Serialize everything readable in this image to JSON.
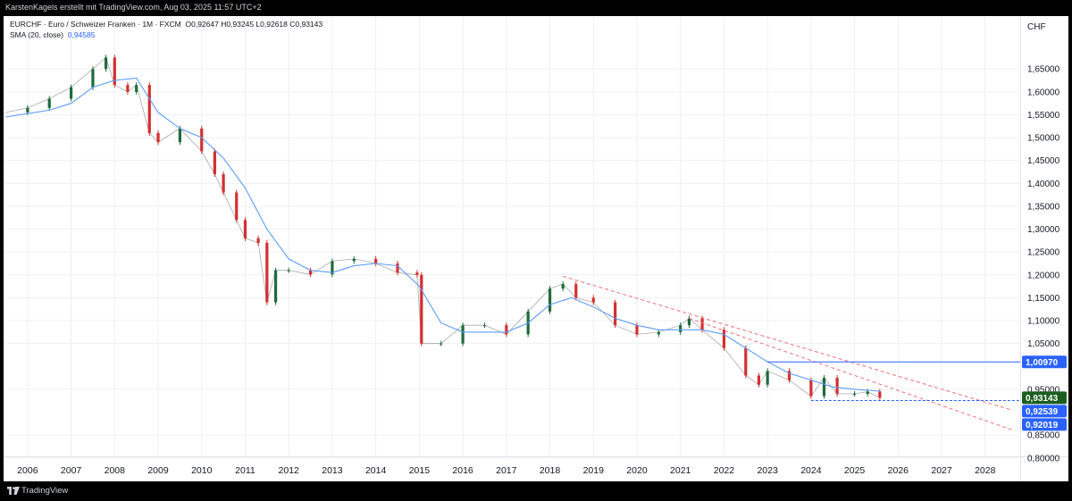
{
  "header": {
    "attribution": "KarstenKagels erstellt mit TradingView.com, Aug 03, 2025 11:57 UTC+2"
  },
  "legend": {
    "symbol": "EURCHF · Euro / Schweizer Franken · 1M · FXCM",
    "ohlc": "O0,92647  H0,93245  L0,92618  C0,93143",
    "sma_label": "SMA (20, close)",
    "sma_value": "0,94585"
  },
  "footer": {
    "brand": "TradingView"
  },
  "colors": {
    "up": "#1e6b3c",
    "down": "#d32f2f",
    "sma": "#5b9cf6",
    "level_line": "#2962ff",
    "trend": "#f0717c",
    "price_tag": "#1b5e20"
  },
  "chart_data": {
    "type": "line",
    "title": "",
    "currency_label": "CHF",
    "ylim": [
      0.78,
      1.75
    ],
    "y_ticks": [
      {
        "v": 1.65,
        "label": "1,65000"
      },
      {
        "v": 1.6,
        "label": "1,60000"
      },
      {
        "v": 1.55,
        "label": "1,55000"
      },
      {
        "v": 1.5,
        "label": "1,50000"
      },
      {
        "v": 1.45,
        "label": "1,45000"
      },
      {
        "v": 1.4,
        "label": "1,40000"
      },
      {
        "v": 1.35,
        "label": "1,35000"
      },
      {
        "v": 1.3,
        "label": "1,30000"
      },
      {
        "v": 1.25,
        "label": "1,25000"
      },
      {
        "v": 1.2,
        "label": "1,20000"
      },
      {
        "v": 1.15,
        "label": "1,15000"
      },
      {
        "v": 1.1,
        "label": "1,10000"
      },
      {
        "v": 1.05,
        "label": "1,05000"
      },
      {
        "v": 0.95,
        "label": "0,95000"
      },
      {
        "v": 0.85,
        "label": "0,85000"
      },
      {
        "v": 0.8,
        "label": "0,80000"
      }
    ],
    "x_range": [
      2005.5,
      2028.6
    ],
    "x_ticks": [
      "2006",
      "2007",
      "2008",
      "2009",
      "2010",
      "2011",
      "2012",
      "2013",
      "2014",
      "2015",
      "2016",
      "2017",
      "2018",
      "2019",
      "2020",
      "2021",
      "2022",
      "2023",
      "2024",
      "2025",
      "2026",
      "2027",
      "2028"
    ],
    "series": [
      {
        "name": "EURCHF",
        "kind": "candlestick_monthly_close",
        "x": [
          2005.5,
          2006.0,
          2006.5,
          2007.0,
          2007.5,
          2007.8,
          2008.0,
          2008.3,
          2008.5,
          2008.8,
          2009.0,
          2009.5,
          2010.0,
          2010.3,
          2010.5,
          2010.8,
          2011.0,
          2011.3,
          2011.5,
          2011.7,
          2012.0,
          2012.5,
          2013.0,
          2013.5,
          2014.0,
          2014.5,
          2014.95,
          2015.05,
          2015.5,
          2016.0,
          2016.5,
          2017.0,
          2017.5,
          2018.0,
          2018.3,
          2018.6,
          2019.0,
          2019.5,
          2020.0,
          2020.5,
          2021.0,
          2021.2,
          2021.5,
          2022.0,
          2022.5,
          2022.8,
          2023.0,
          2023.5,
          2024.0,
          2024.3,
          2024.6,
          2025.0,
          2025.3,
          2025.58
        ],
        "y": [
          1.555,
          1.565,
          1.585,
          1.61,
          1.65,
          1.675,
          1.615,
          1.6,
          1.615,
          1.51,
          1.49,
          1.52,
          1.47,
          1.42,
          1.38,
          1.32,
          1.28,
          1.27,
          1.14,
          1.21,
          1.21,
          1.201,
          1.23,
          1.235,
          1.225,
          1.205,
          1.2,
          1.05,
          1.05,
          1.09,
          1.09,
          1.07,
          1.12,
          1.17,
          1.18,
          1.15,
          1.14,
          1.09,
          1.07,
          1.075,
          1.09,
          1.105,
          1.08,
          1.04,
          0.98,
          0.96,
          0.99,
          0.97,
          0.935,
          0.975,
          0.94,
          0.94,
          0.945,
          0.93143
        ]
      },
      {
        "name": "SMA (20, close)",
        "x": [
          2005.5,
          2006.5,
          2007.0,
          2007.5,
          2008.0,
          2008.5,
          2009.0,
          2009.5,
          2010.0,
          2010.5,
          2011.0,
          2011.5,
          2012.0,
          2012.5,
          2013.0,
          2013.5,
          2014.0,
          2014.5,
          2015.0,
          2015.5,
          2016.0,
          2016.5,
          2017.0,
          2017.5,
          2018.0,
          2018.5,
          2019.0,
          2019.5,
          2020.0,
          2020.5,
          2021.0,
          2021.5,
          2022.0,
          2022.5,
          2023.0,
          2023.5,
          2024.0,
          2024.5,
          2025.0,
          2025.58
        ],
        "y": [
          1.545,
          1.56,
          1.575,
          1.61,
          1.625,
          1.63,
          1.555,
          1.52,
          1.5,
          1.455,
          1.39,
          1.3,
          1.235,
          1.21,
          1.205,
          1.22,
          1.225,
          1.22,
          1.175,
          1.095,
          1.075,
          1.075,
          1.075,
          1.095,
          1.135,
          1.15,
          1.13,
          1.105,
          1.09,
          1.08,
          1.08,
          1.08,
          1.07,
          1.04,
          1.01,
          0.985,
          0.97,
          0.955,
          0.95,
          0.94585
        ]
      }
    ],
    "horizontal_lines": [
      {
        "name": "level-1.00970",
        "value": 1.0097,
        "label": "1,00970",
        "color": "#2962ff",
        "start_x": 2023.0
      },
      {
        "name": "level-0.92539",
        "value": 0.92539,
        "label": "0,92539",
        "color": "#2962ff",
        "start_x": 2024.0
      }
    ],
    "trend_lines": [
      {
        "name": "upper-trendline",
        "x1": 2018.3,
        "y1": 1.197,
        "x2": 2028.6,
        "y2": 0.905
      },
      {
        "name": "lower-trendline",
        "x1": 2021.2,
        "y1": 1.105,
        "x2": 2028.6,
        "y2": 0.862
      }
    ],
    "price_tags": [
      {
        "name": "last-price-tag",
        "value": 0.93143,
        "label": "0,93143",
        "color": "#1b5e20"
      },
      {
        "name": "level-tag-1",
        "value": 1.0097,
        "label": "1,00970",
        "color": "#2962ff"
      },
      {
        "name": "level-tag-2",
        "value": 0.92539,
        "label": "0,92539",
        "color": "#2962ff"
      },
      {
        "name": "level-tag-3",
        "value": 0.92019,
        "label": "0,92019",
        "color": "#2962ff"
      }
    ],
    "grid": true
  }
}
